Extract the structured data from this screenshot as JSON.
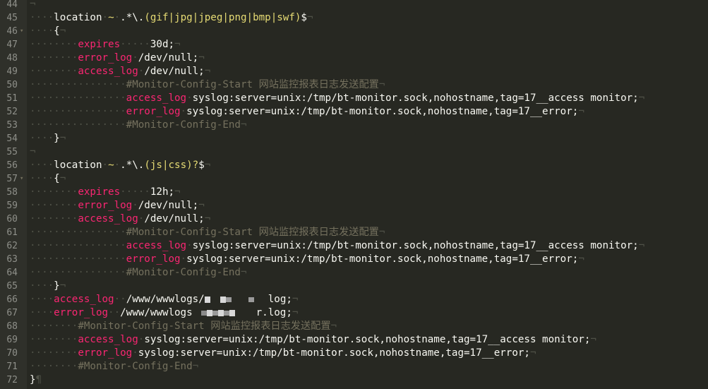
{
  "editor": {
    "lines": [
      {
        "n": "44",
        "fold": "",
        "segs": [
          {
            "c": "ws",
            "t": "¬"
          }
        ]
      },
      {
        "n": "45",
        "fold": "",
        "segs": [
          {
            "c": "ws",
            "t": "····"
          },
          {
            "c": "tx",
            "t": "location"
          },
          {
            "c": "ws",
            "t": "·"
          },
          {
            "c": "rx",
            "t": "~"
          },
          {
            "c": "ws",
            "t": "·"
          },
          {
            "c": "tx",
            "t": ".*\\."
          },
          {
            "c": "rx",
            "t": "(gif|jpg|jpeg|png|bmp|swf)"
          },
          {
            "c": "tx",
            "t": "$"
          },
          {
            "c": "ws",
            "t": "¬"
          }
        ]
      },
      {
        "n": "46",
        "fold": "▾",
        "segs": [
          {
            "c": "ws",
            "t": "····"
          },
          {
            "c": "tx",
            "t": "{"
          },
          {
            "c": "ws",
            "t": "¬"
          }
        ]
      },
      {
        "n": "47",
        "fold": "",
        "segs": [
          {
            "c": "ws",
            "t": "········"
          },
          {
            "c": "kw",
            "t": "expires"
          },
          {
            "c": "ws",
            "t": "·····"
          },
          {
            "c": "tx",
            "t": "30d;"
          },
          {
            "c": "ws",
            "t": "¬"
          }
        ]
      },
      {
        "n": "48",
        "fold": "",
        "segs": [
          {
            "c": "ws",
            "t": "········"
          },
          {
            "c": "kw",
            "t": "error_log"
          },
          {
            "c": "ws",
            "t": "·"
          },
          {
            "c": "tx",
            "t": "/dev/null;"
          },
          {
            "c": "ws",
            "t": "¬"
          }
        ]
      },
      {
        "n": "49",
        "fold": "",
        "segs": [
          {
            "c": "ws",
            "t": "········"
          },
          {
            "c": "kw",
            "t": "access_log"
          },
          {
            "c": "ws",
            "t": "·"
          },
          {
            "c": "tx",
            "t": "/dev/null;"
          },
          {
            "c": "ws",
            "t": "¬"
          }
        ]
      },
      {
        "n": "50",
        "fold": "",
        "segs": [
          {
            "c": "ws",
            "t": "················"
          },
          {
            "c": "cm",
            "t": "#Monitor-Config-Start 网站监控报表日志发送配置"
          },
          {
            "c": "ws",
            "t": "¬"
          }
        ]
      },
      {
        "n": "51",
        "fold": "",
        "segs": [
          {
            "c": "ws",
            "t": "················"
          },
          {
            "c": "kw",
            "t": "access_log"
          },
          {
            "c": "ws",
            "t": "·"
          },
          {
            "c": "tx",
            "t": "syslog:server=unix:/tmp/bt-monitor.sock,nohostname,tag=17__access monitor;"
          },
          {
            "c": "ws",
            "t": "¬"
          }
        ]
      },
      {
        "n": "52",
        "fold": "",
        "segs": [
          {
            "c": "ws",
            "t": "················"
          },
          {
            "c": "kw",
            "t": "error_log"
          },
          {
            "c": "ws",
            "t": "·"
          },
          {
            "c": "tx",
            "t": "syslog:server=unix:/tmp/bt-monitor.sock,nohostname,tag=17__error;"
          },
          {
            "c": "ws",
            "t": "¬"
          }
        ]
      },
      {
        "n": "53",
        "fold": "",
        "segs": [
          {
            "c": "ws",
            "t": "················"
          },
          {
            "c": "cm",
            "t": "#Monitor-Config-End"
          },
          {
            "c": "ws",
            "t": "¬"
          }
        ]
      },
      {
        "n": "54",
        "fold": "",
        "segs": [
          {
            "c": "ws",
            "t": "····"
          },
          {
            "c": "tx",
            "t": "}"
          },
          {
            "c": "ws",
            "t": "¬"
          }
        ]
      },
      {
        "n": "55",
        "fold": "",
        "segs": [
          {
            "c": "ws",
            "t": "¬"
          }
        ]
      },
      {
        "n": "56",
        "fold": "",
        "segs": [
          {
            "c": "ws",
            "t": "····"
          },
          {
            "c": "tx",
            "t": "location"
          },
          {
            "c": "ws",
            "t": "·"
          },
          {
            "c": "rx",
            "t": "~"
          },
          {
            "c": "ws",
            "t": "·"
          },
          {
            "c": "tx",
            "t": ".*\\."
          },
          {
            "c": "rx",
            "t": "(js|css)?"
          },
          {
            "c": "tx",
            "t": "$"
          },
          {
            "c": "ws",
            "t": "¬"
          }
        ]
      },
      {
        "n": "57",
        "fold": "▾",
        "segs": [
          {
            "c": "ws",
            "t": "····"
          },
          {
            "c": "tx",
            "t": "{"
          },
          {
            "c": "ws",
            "t": "¬"
          }
        ]
      },
      {
        "n": "58",
        "fold": "",
        "segs": [
          {
            "c": "ws",
            "t": "········"
          },
          {
            "c": "kw",
            "t": "expires"
          },
          {
            "c": "ws",
            "t": "·····"
          },
          {
            "c": "tx",
            "t": "12h;"
          },
          {
            "c": "ws",
            "t": "¬"
          }
        ]
      },
      {
        "n": "59",
        "fold": "",
        "segs": [
          {
            "c": "ws",
            "t": "········"
          },
          {
            "c": "kw",
            "t": "error_log"
          },
          {
            "c": "ws",
            "t": "·"
          },
          {
            "c": "tx",
            "t": "/dev/null;"
          },
          {
            "c": "ws",
            "t": "¬"
          }
        ]
      },
      {
        "n": "60",
        "fold": "",
        "segs": [
          {
            "c": "ws",
            "t": "········"
          },
          {
            "c": "kw",
            "t": "access_log"
          },
          {
            "c": "ws",
            "t": "·"
          },
          {
            "c": "tx",
            "t": "/dev/null;"
          },
          {
            "c": "ws",
            "t": "¬"
          }
        ]
      },
      {
        "n": "61",
        "fold": "",
        "segs": [
          {
            "c": "ws",
            "t": "················"
          },
          {
            "c": "cm",
            "t": "#Monitor-Config-Start 网站监控报表日志发送配置"
          },
          {
            "c": "ws",
            "t": "¬"
          }
        ]
      },
      {
        "n": "62",
        "fold": "",
        "segs": [
          {
            "c": "ws",
            "t": "················"
          },
          {
            "c": "kw",
            "t": "access_log"
          },
          {
            "c": "ws",
            "t": "·"
          },
          {
            "c": "tx",
            "t": "syslog:server=unix:/tmp/bt-monitor.sock,nohostname,tag=17__access monitor;"
          },
          {
            "c": "ws",
            "t": "¬"
          }
        ]
      },
      {
        "n": "63",
        "fold": "",
        "segs": [
          {
            "c": "ws",
            "t": "················"
          },
          {
            "c": "kw",
            "t": "error_log"
          },
          {
            "c": "ws",
            "t": "·"
          },
          {
            "c": "tx",
            "t": "syslog:server=unix:/tmp/bt-monitor.sock,nohostname,tag=17__error;"
          },
          {
            "c": "ws",
            "t": "¬"
          }
        ]
      },
      {
        "n": "64",
        "fold": "",
        "segs": [
          {
            "c": "ws",
            "t": "················"
          },
          {
            "c": "cm",
            "t": "#Monitor-Config-End"
          },
          {
            "c": "ws",
            "t": "¬"
          }
        ]
      },
      {
        "n": "65",
        "fold": "",
        "segs": [
          {
            "c": "ws",
            "t": "····"
          },
          {
            "c": "tx",
            "t": "}"
          },
          {
            "c": "ws",
            "t": "¬"
          }
        ]
      },
      {
        "n": "66",
        "fold": "",
        "segs": [
          {
            "c": "ws",
            "t": "····"
          },
          {
            "c": "kw",
            "t": "access_log"
          },
          {
            "c": "ws",
            "t": "··"
          },
          {
            "c": "tx",
            "t": "/www/wwwlogs/"
          },
          {
            "c": "redact",
            "t": "a"
          },
          {
            "c": "tx",
            "t": "log;"
          },
          {
            "c": "ws",
            "t": "¬"
          }
        ]
      },
      {
        "n": "67",
        "fold": "",
        "segs": [
          {
            "c": "ws",
            "t": "····"
          },
          {
            "c": "kw",
            "t": "error_log"
          },
          {
            "c": "ws",
            "t": "··"
          },
          {
            "c": "tx",
            "t": "/www/wwwlogs"
          },
          {
            "c": "redact",
            "t": "b"
          },
          {
            "c": "tx",
            "t": "r.log;"
          },
          {
            "c": "ws",
            "t": "¬"
          }
        ]
      },
      {
        "n": "68",
        "fold": "",
        "segs": [
          {
            "c": "ws",
            "t": "········"
          },
          {
            "c": "cm",
            "t": "#Monitor-Config-Start 网站监控报表日志发送配置"
          },
          {
            "c": "ws",
            "t": "¬"
          }
        ]
      },
      {
        "n": "69",
        "fold": "",
        "segs": [
          {
            "c": "ws",
            "t": "········"
          },
          {
            "c": "kw",
            "t": "access_log"
          },
          {
            "c": "ws",
            "t": "·"
          },
          {
            "c": "tx",
            "t": "syslog:server=unix:/tmp/bt-monitor.sock,nohostname,tag=17__access monitor;"
          },
          {
            "c": "ws",
            "t": "¬"
          }
        ]
      },
      {
        "n": "70",
        "fold": "",
        "segs": [
          {
            "c": "ws",
            "t": "········"
          },
          {
            "c": "kw",
            "t": "error_log"
          },
          {
            "c": "ws",
            "t": "·"
          },
          {
            "c": "tx",
            "t": "syslog:server=unix:/tmp/bt-monitor.sock,nohostname,tag=17__error;"
          },
          {
            "c": "ws",
            "t": "¬"
          }
        ]
      },
      {
        "n": "71",
        "fold": "",
        "segs": [
          {
            "c": "ws",
            "t": "········"
          },
          {
            "c": "cm",
            "t": "#Monitor-Config-End"
          },
          {
            "c": "ws",
            "t": "¬"
          }
        ]
      },
      {
        "n": "72",
        "fold": "",
        "segs": [
          {
            "c": "tx",
            "t": "}"
          },
          {
            "c": "ws",
            "t": "¶"
          }
        ]
      }
    ]
  },
  "colors": {
    "background": "#272822",
    "keyword": "#f92672",
    "comment": "#75715e",
    "regex": "#e6db74",
    "text": "#f8f8f2"
  }
}
